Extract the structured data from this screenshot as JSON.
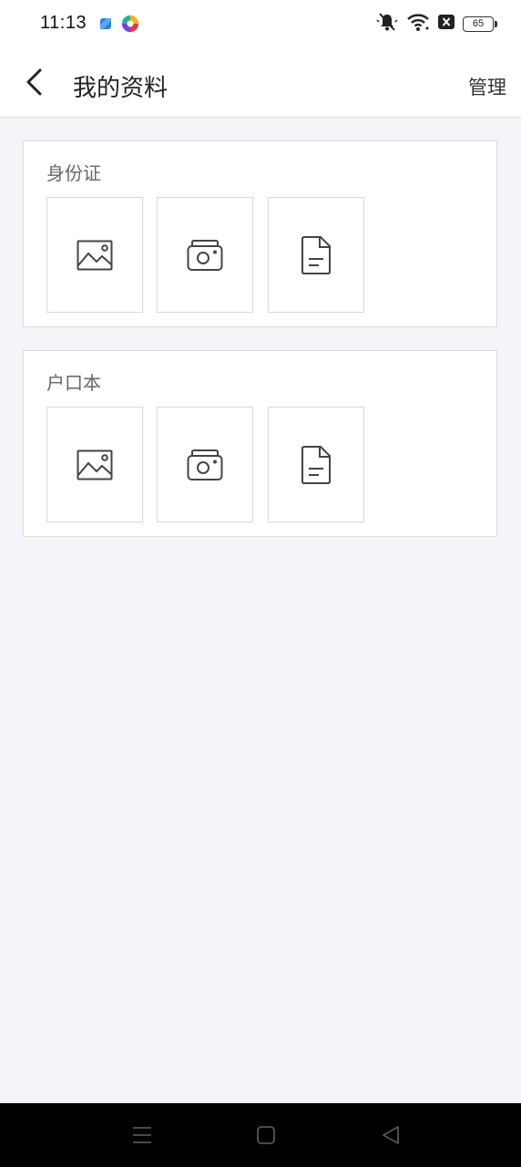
{
  "status_bar": {
    "time": "11:13",
    "battery": "65",
    "icons": [
      "app-blue-icon",
      "app-colorful-icon",
      "mute-icon",
      "wifi-icon",
      "sim-error-icon",
      "battery-icon"
    ]
  },
  "header": {
    "title": "我的资料",
    "action_label": "管理",
    "back_icon": "chevron-left-icon"
  },
  "sections": [
    {
      "title": "身份证",
      "actions": [
        {
          "icon": "image-icon"
        },
        {
          "icon": "camera-icon"
        },
        {
          "icon": "document-icon"
        }
      ]
    },
    {
      "title": "户口本",
      "actions": [
        {
          "icon": "image-icon"
        },
        {
          "icon": "camera-icon"
        },
        {
          "icon": "document-icon"
        }
      ]
    }
  ],
  "system_nav": {
    "icons": [
      "menu-icon",
      "home-icon",
      "back-triangle-icon"
    ]
  },
  "colors": {
    "background": "#f4f5f9",
    "card": "#ffffff",
    "border": "#dcdcdc",
    "icon": "#444444"
  }
}
